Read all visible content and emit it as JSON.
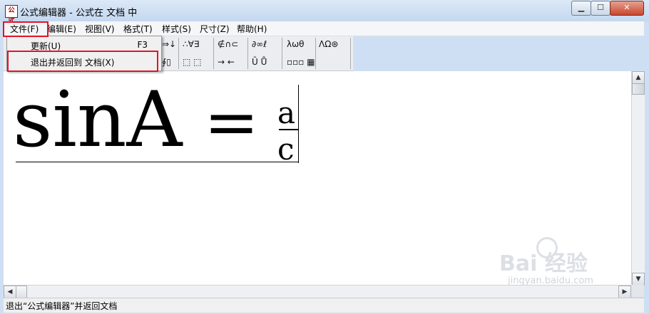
{
  "window": {
    "title": "公式编辑器 - 公式在 文档 中",
    "app_icon": "公式"
  },
  "menubar": {
    "items": [
      {
        "label": "文件(F)"
      },
      {
        "label": "编辑(E)"
      },
      {
        "label": "视图(V)"
      },
      {
        "label": "格式(T)"
      },
      {
        "label": "样式(S)"
      },
      {
        "label": "尺寸(Z)"
      },
      {
        "label": "帮助(H)"
      }
    ]
  },
  "file_menu": {
    "items": [
      {
        "label": "更新(U)",
        "shortcut": "F3"
      },
      {
        "label": "退出并返回到 文档(X)",
        "shortcut": ""
      }
    ]
  },
  "toolbar": {
    "row1": [
      "⇒↓",
      "∴∀∃",
      "∉∩⊂",
      "∂∞ℓ",
      "λωθ",
      "ΛΩ⊛"
    ],
    "row2": [
      "∮▯",
      "⬚ ⬚",
      "→ ←",
      "Ū Ů",
      "▫▫▫ ▦"
    ]
  },
  "formula": {
    "lhs": "sinA",
    "eq": "=",
    "numerator": "a",
    "denominator": "c"
  },
  "status": {
    "text": "退出“公式编辑器”并返回文档"
  },
  "watermark": {
    "brand": "Bai  经验",
    "url": "jingyan.baidu.com"
  },
  "colors": {
    "highlight": "#e0152a",
    "close": "#c7472e"
  }
}
